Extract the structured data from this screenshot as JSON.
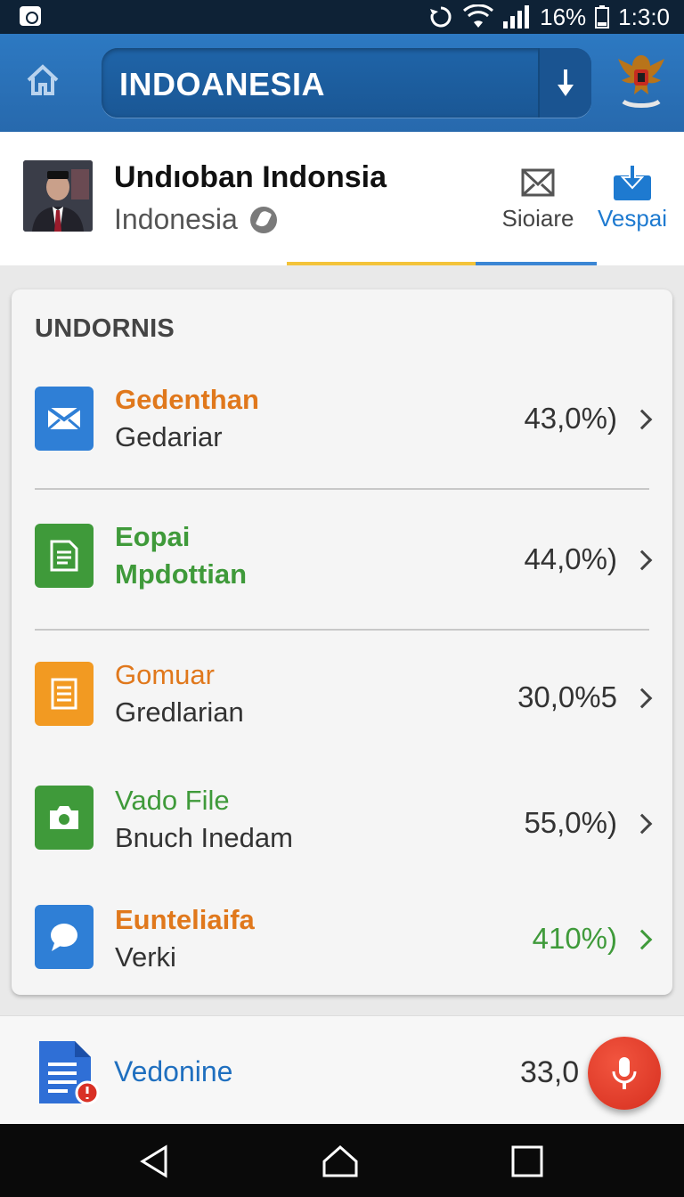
{
  "status_bar": {
    "battery": "16%",
    "time": "1:3:0"
  },
  "app_bar": {
    "search_label": "INDOANESIA",
    "icons": [
      "home-icon",
      "download-icon",
      "garuda-emblem"
    ]
  },
  "profile": {
    "name": "Undıoban Indonsia",
    "country": "Indonesia",
    "actions": [
      {
        "label": "Sioiare",
        "icon": "mail-icon"
      },
      {
        "label": "Vespai",
        "icon": "share-icon"
      }
    ]
  },
  "card": {
    "title": "UNDORNIS",
    "items": [
      {
        "title": "Gedenthan",
        "subtitle": "Gedariar",
        "value": "43,0%)",
        "icon": "mail-icon",
        "icon_color": "#2f7fd6",
        "title_color": "#e0781c"
      },
      {
        "title": "Eopai",
        "subtitle": "Mpdottian",
        "value": "44,0%)",
        "icon": "document-icon",
        "icon_color": "#3f9a3a",
        "title_color": "#3f9a3a"
      },
      {
        "title": "Gomuar",
        "subtitle": "Gredlarian",
        "value": "30,0%5",
        "icon": "notes-icon",
        "icon_color": "#f29a22",
        "title_color": "#e0781c"
      },
      {
        "title": "Vado File",
        "subtitle": "Bnuch Inedam",
        "value": "55,0%)",
        "icon": "camera-icon",
        "icon_color": "#3f9a3a",
        "title_color": "#3f9a3a"
      },
      {
        "title": "Eunteliaifa",
        "subtitle": "Verki",
        "value": "410%)",
        "icon": "chat-icon",
        "icon_color": "#2f7fd6",
        "title_color": "#e0781c",
        "value_color": "#3f9a3a"
      }
    ]
  },
  "bottom_item": {
    "label": "Vedonine",
    "value": "33,0"
  },
  "nav": [
    "back-icon",
    "home-icon",
    "recents-icon"
  ],
  "colors": {
    "app_bar": "#2d79c2",
    "accent_yellow": "#f3c33a",
    "accent_blue": "#3b86d4",
    "fab": "#e2402c"
  }
}
